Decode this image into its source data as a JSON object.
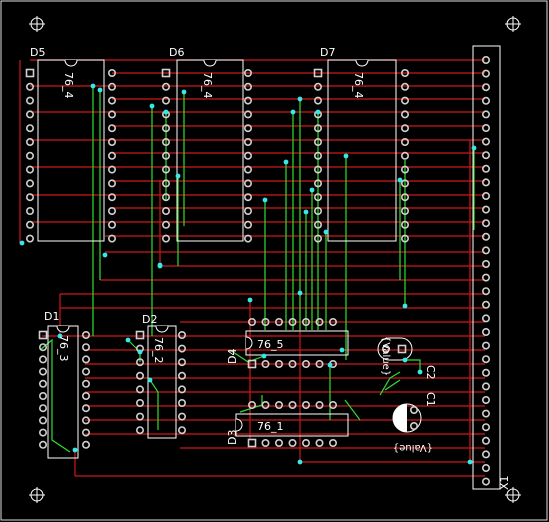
{
  "board": {
    "background": "#000000",
    "outline_color": "#e0e0e0",
    "colors": {
      "trace_top": "#d01818",
      "trace_bottom": "#2ee02e",
      "via": "#38e8e8",
      "pad_ring": "#d0d0d0",
      "silk": "#ffffff"
    }
  },
  "components": {
    "D5": {
      "ref": "D5",
      "value": "76_4"
    },
    "D6": {
      "ref": "D6",
      "value": "76_4"
    },
    "D7": {
      "ref": "D7",
      "value": "76_4"
    },
    "D1": {
      "ref": "D1",
      "value": "76_3"
    },
    "D2": {
      "ref": "D2",
      "value": "76_2"
    },
    "D4": {
      "ref": "D4",
      "value": "76_5"
    },
    "D3": {
      "ref": "D3",
      "value": "76_1"
    },
    "C2": {
      "ref": "C2",
      "value": "{Value}"
    },
    "C1": {
      "ref": "C1",
      "value": "{Value}"
    },
    "X1": {
      "ref": "X1"
    }
  }
}
